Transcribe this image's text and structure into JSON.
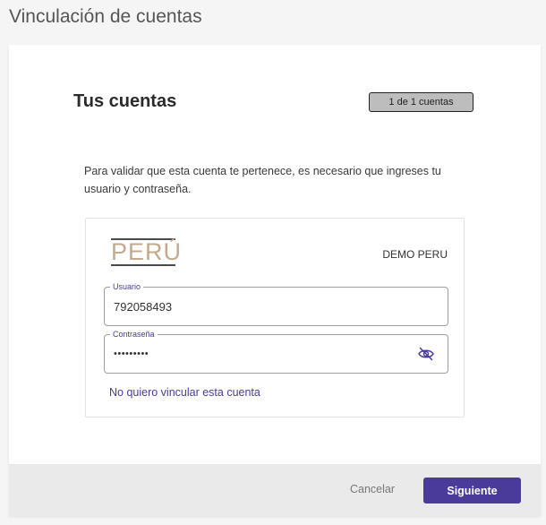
{
  "page": {
    "title": "Vinculación de cuentas"
  },
  "card": {
    "heading": "Tus cuentas",
    "counter": "1 de 1 cuentas",
    "instructions": "Para validar que esta cuenta te pertenece, es necesario que ingreses tu usuario y contraseña."
  },
  "account": {
    "logo_text": "PERÚ",
    "entity_name": "DEMO PERU",
    "user_field": {
      "label": "Usuario",
      "value": "792058493"
    },
    "password_field": {
      "label": "Contraseña",
      "value": "•••••••••",
      "toggle_icon": "eye-off-icon"
    },
    "unlink_text": "No quiero vincular esta cuenta"
  },
  "footer": {
    "cancel_label": "Cancelar",
    "next_label": "Siguiente"
  },
  "colors": {
    "accent": "#4a3b9a",
    "logo": "#c4a98c",
    "footer_bg": "#eaeaea"
  }
}
